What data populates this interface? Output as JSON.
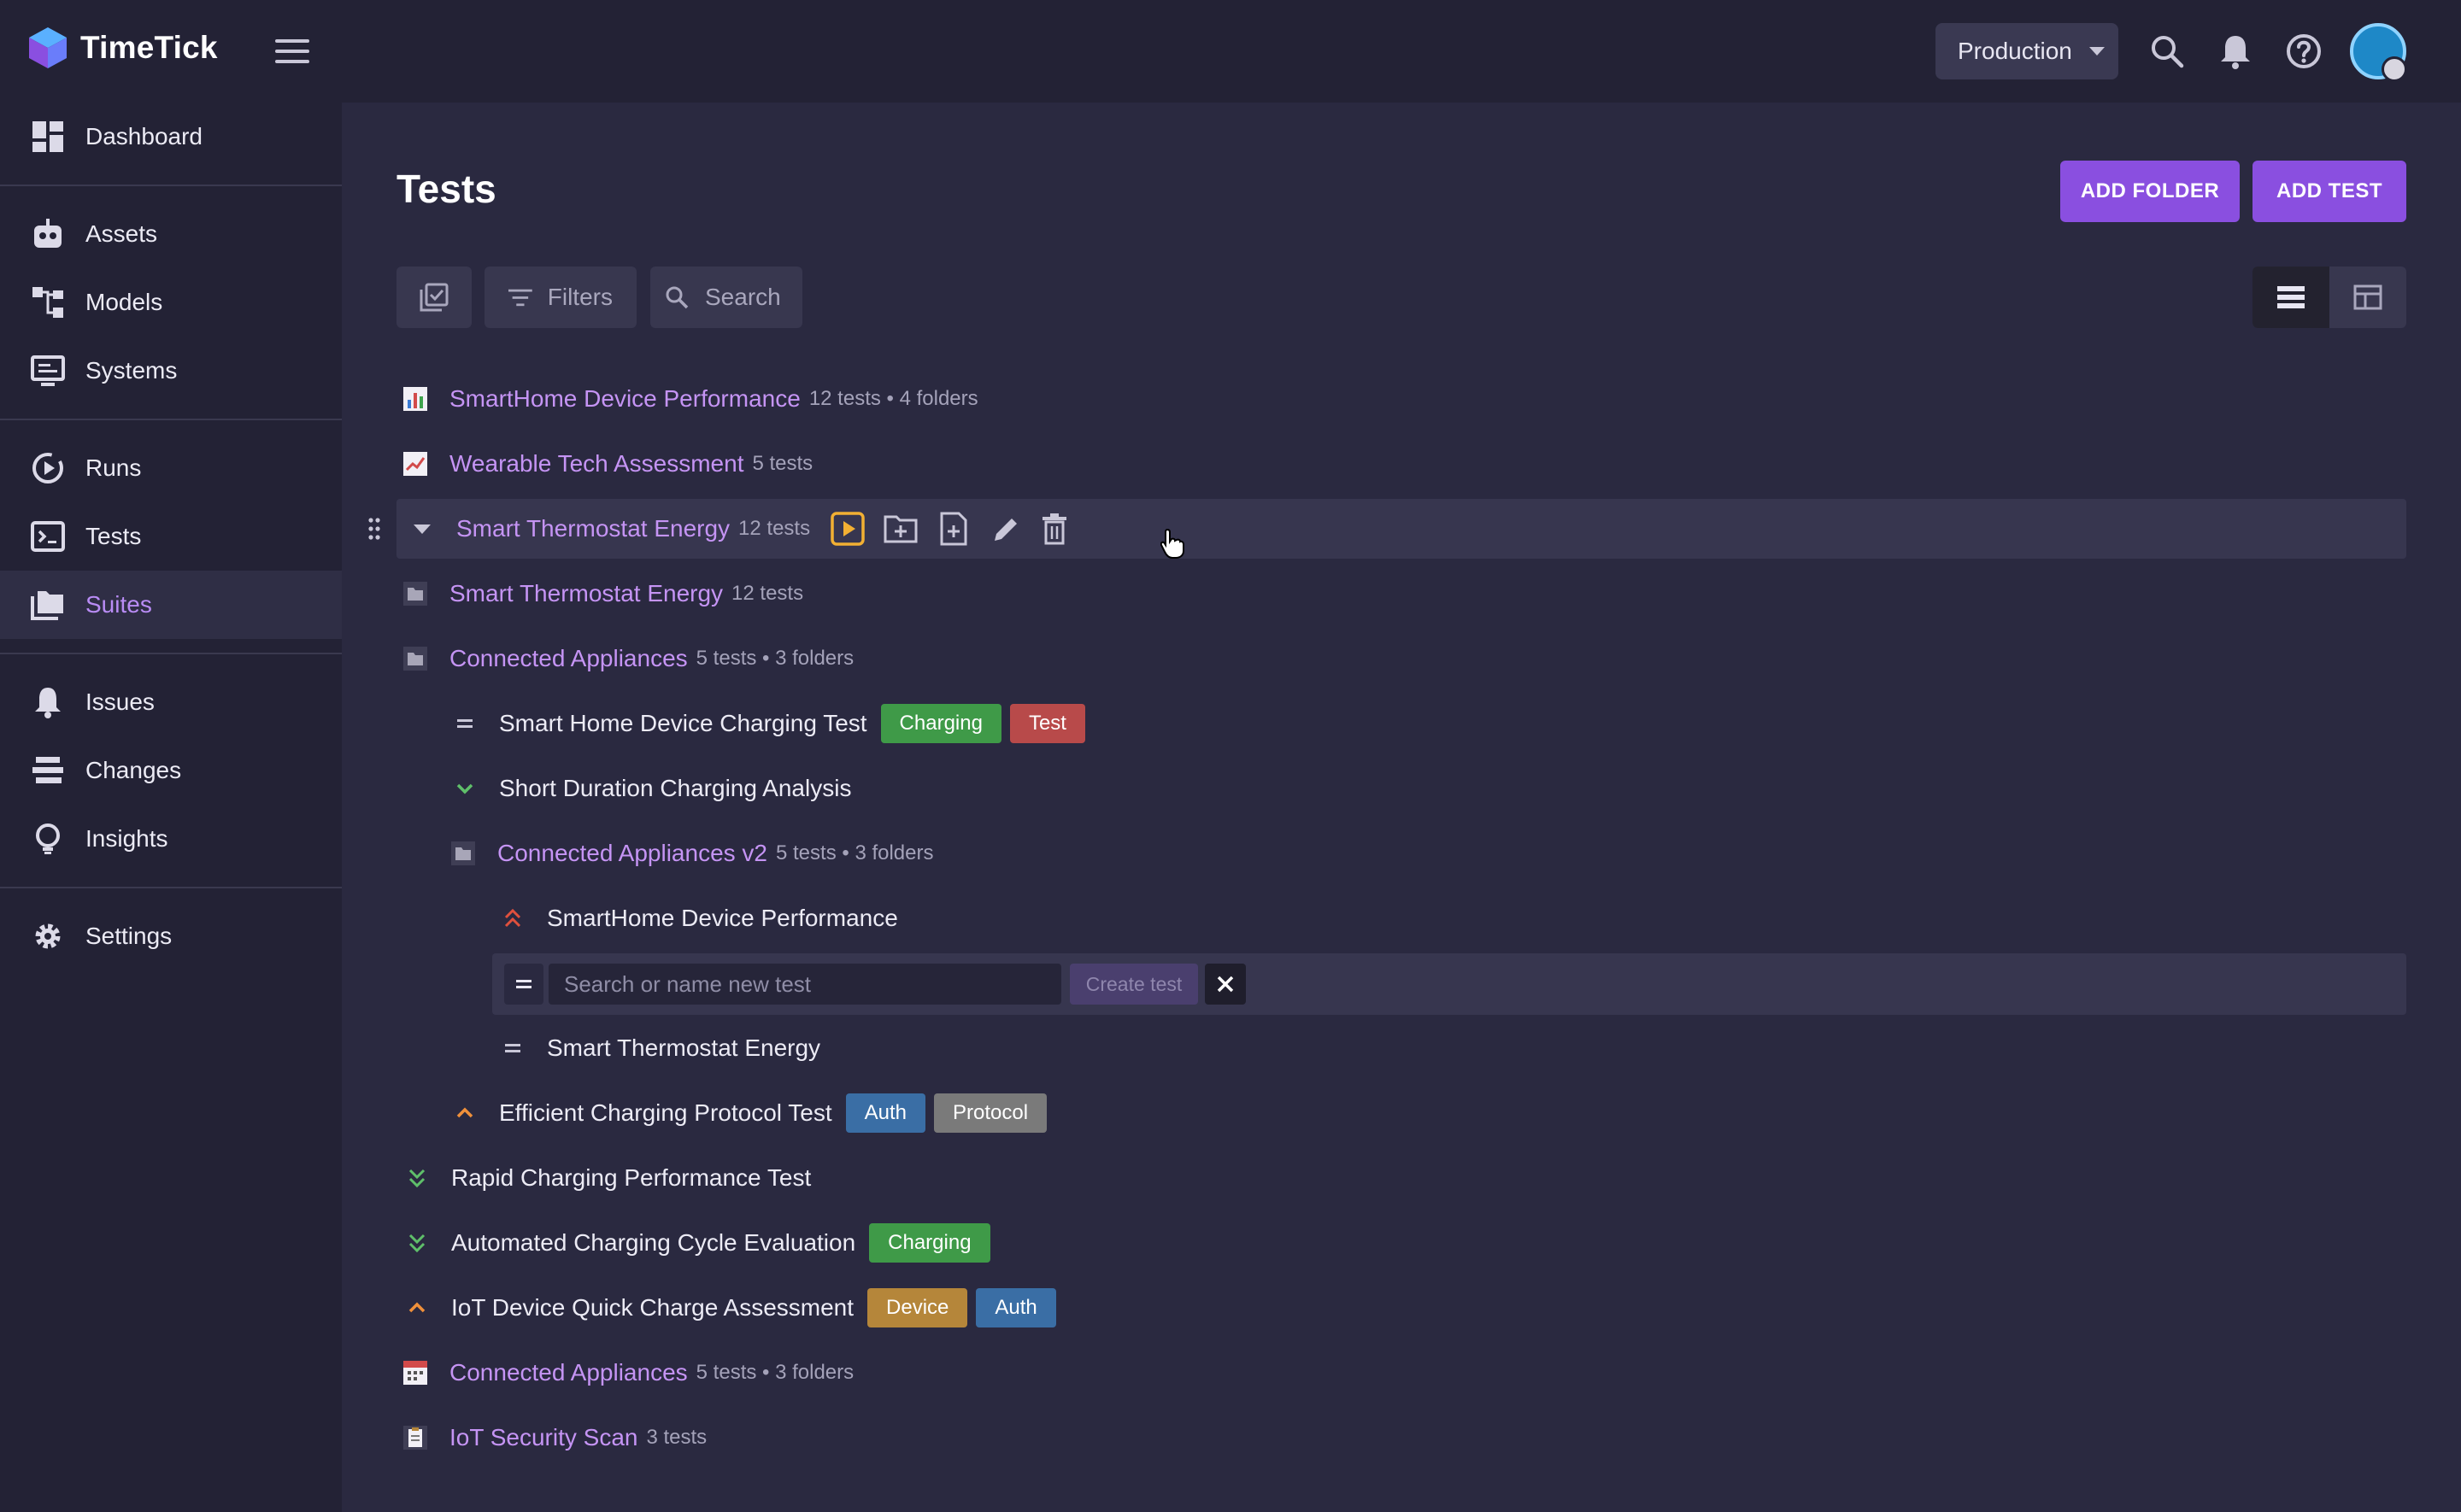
{
  "app": {
    "name": "TimeTick"
  },
  "header": {
    "environment": "Production",
    "icons": [
      "search-icon",
      "bell-icon",
      "help-icon",
      "avatar"
    ]
  },
  "sidebar": {
    "items": [
      {
        "label": "Dashboard",
        "icon": "dashboard-icon"
      },
      {
        "label": "Assets",
        "icon": "robot-icon"
      },
      {
        "label": "Models",
        "icon": "hierarchy-icon"
      },
      {
        "label": "Systems",
        "icon": "monitor-icon"
      },
      {
        "label": "Runs",
        "icon": "play-circle-icon"
      },
      {
        "label": "Tests",
        "icon": "terminal-icon"
      },
      {
        "label": "Suites",
        "icon": "folders-icon",
        "active": true
      },
      {
        "label": "Issues",
        "icon": "bell-icon"
      },
      {
        "label": "Changes",
        "icon": "layers-icon"
      },
      {
        "label": "Insights",
        "icon": "lightbulb-icon"
      },
      {
        "label": "Settings",
        "icon": "gear-icon"
      }
    ]
  },
  "main": {
    "title": "Tests",
    "add_folder": "ADD FOLDER",
    "add_test": "ADD TEST",
    "filters": "Filters",
    "search": "Search",
    "new_test": {
      "placeholder": "Search or name new test",
      "create": "Create test"
    }
  },
  "tree": [
    {
      "name": "SmartHome Device Performance",
      "meta": "12 tests • 4 folders"
    },
    {
      "name": "Wearable Tech Assessment",
      "meta": "5 tests"
    },
    {
      "name": "Smart Thermostat Energy",
      "meta": "12 tests"
    },
    {
      "name": "Smart Thermostat Energy",
      "meta": "12 tests"
    },
    {
      "name": "Connected Appliances",
      "meta": "5 tests • 3 folders"
    },
    {
      "name": "Smart Home Device Charging Test",
      "tags": [
        "Charging",
        "Test"
      ]
    },
    {
      "name": "Short Duration Charging Analysis"
    },
    {
      "name": "Connected Appliances v2",
      "meta": "5 tests • 3 folders"
    },
    {
      "name": "SmartHome Device Performance"
    },
    {
      "name": "Smart Thermostat Energy"
    },
    {
      "name": "Efficient Charging Protocol Test",
      "tags": [
        "Auth",
        "Protocol"
      ]
    },
    {
      "name": "Rapid Charging Performance Test"
    },
    {
      "name": "Automated Charging Cycle Evaluation",
      "tags": [
        "Charging"
      ]
    },
    {
      "name": "IoT Device Quick Charge Assessment",
      "tags": [
        "Device",
        "Auth"
      ]
    },
    {
      "name": "Connected Appliances",
      "meta": "5 tests • 3 folders"
    },
    {
      "name": "IoT Security Scan",
      "meta": "3 tests"
    }
  ],
  "colors": {
    "accent": "#8a4fe0",
    "folder_link": "#c594f4",
    "tag_green": "#3f9a48",
    "tag_red": "#b84a4a",
    "tag_blue": "#3a6ea5",
    "tag_gray": "#7a7a7a",
    "tag_amber": "#b5863a"
  }
}
